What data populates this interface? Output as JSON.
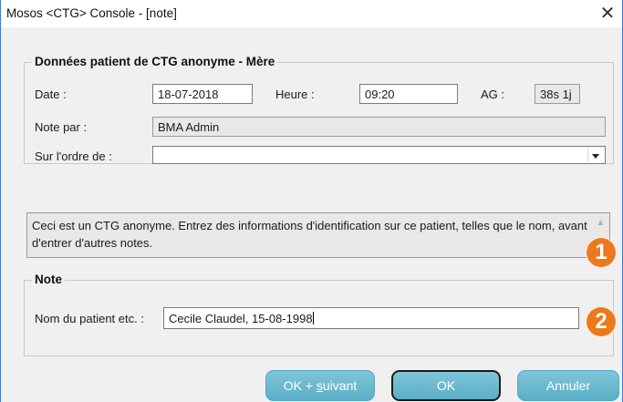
{
  "window": {
    "title": "Mosos <CTG> Console - [note]",
    "close_glyph": "✕"
  },
  "patient_group": {
    "legend": "Données patient de CTG anonyme - Mère",
    "date_label": "Date :",
    "date_value": "18-07-2018",
    "heure_label": "Heure :",
    "heure_value": "09:20",
    "ag_label": "AG :",
    "ag_value": "38s 1j",
    "note_par_label": "Note par :",
    "note_par_value": "BMA Admin",
    "ordre_label": "Sur l'ordre de :",
    "ordre_value": ""
  },
  "info": {
    "text": "Ceci est un CTG anonyme. Entrez des informations d'identification sur ce patient, telles que le nom, avant d'entrer d'autres notes."
  },
  "note_group": {
    "legend": "Note",
    "nom_label": "Nom du patient etc. :",
    "nom_value": "Cecile Claudel, 15-08-1998"
  },
  "badges": {
    "one": "1",
    "two": "2",
    "color": "#ec7a1c"
  },
  "buttons": {
    "ok_suivant_prefix": "OK + ",
    "ok_suivant_underlined": "s",
    "ok_suivant_suffix": "uivant",
    "ok": "OK",
    "annuler": "Annuler",
    "color": "#6bbbd0"
  }
}
